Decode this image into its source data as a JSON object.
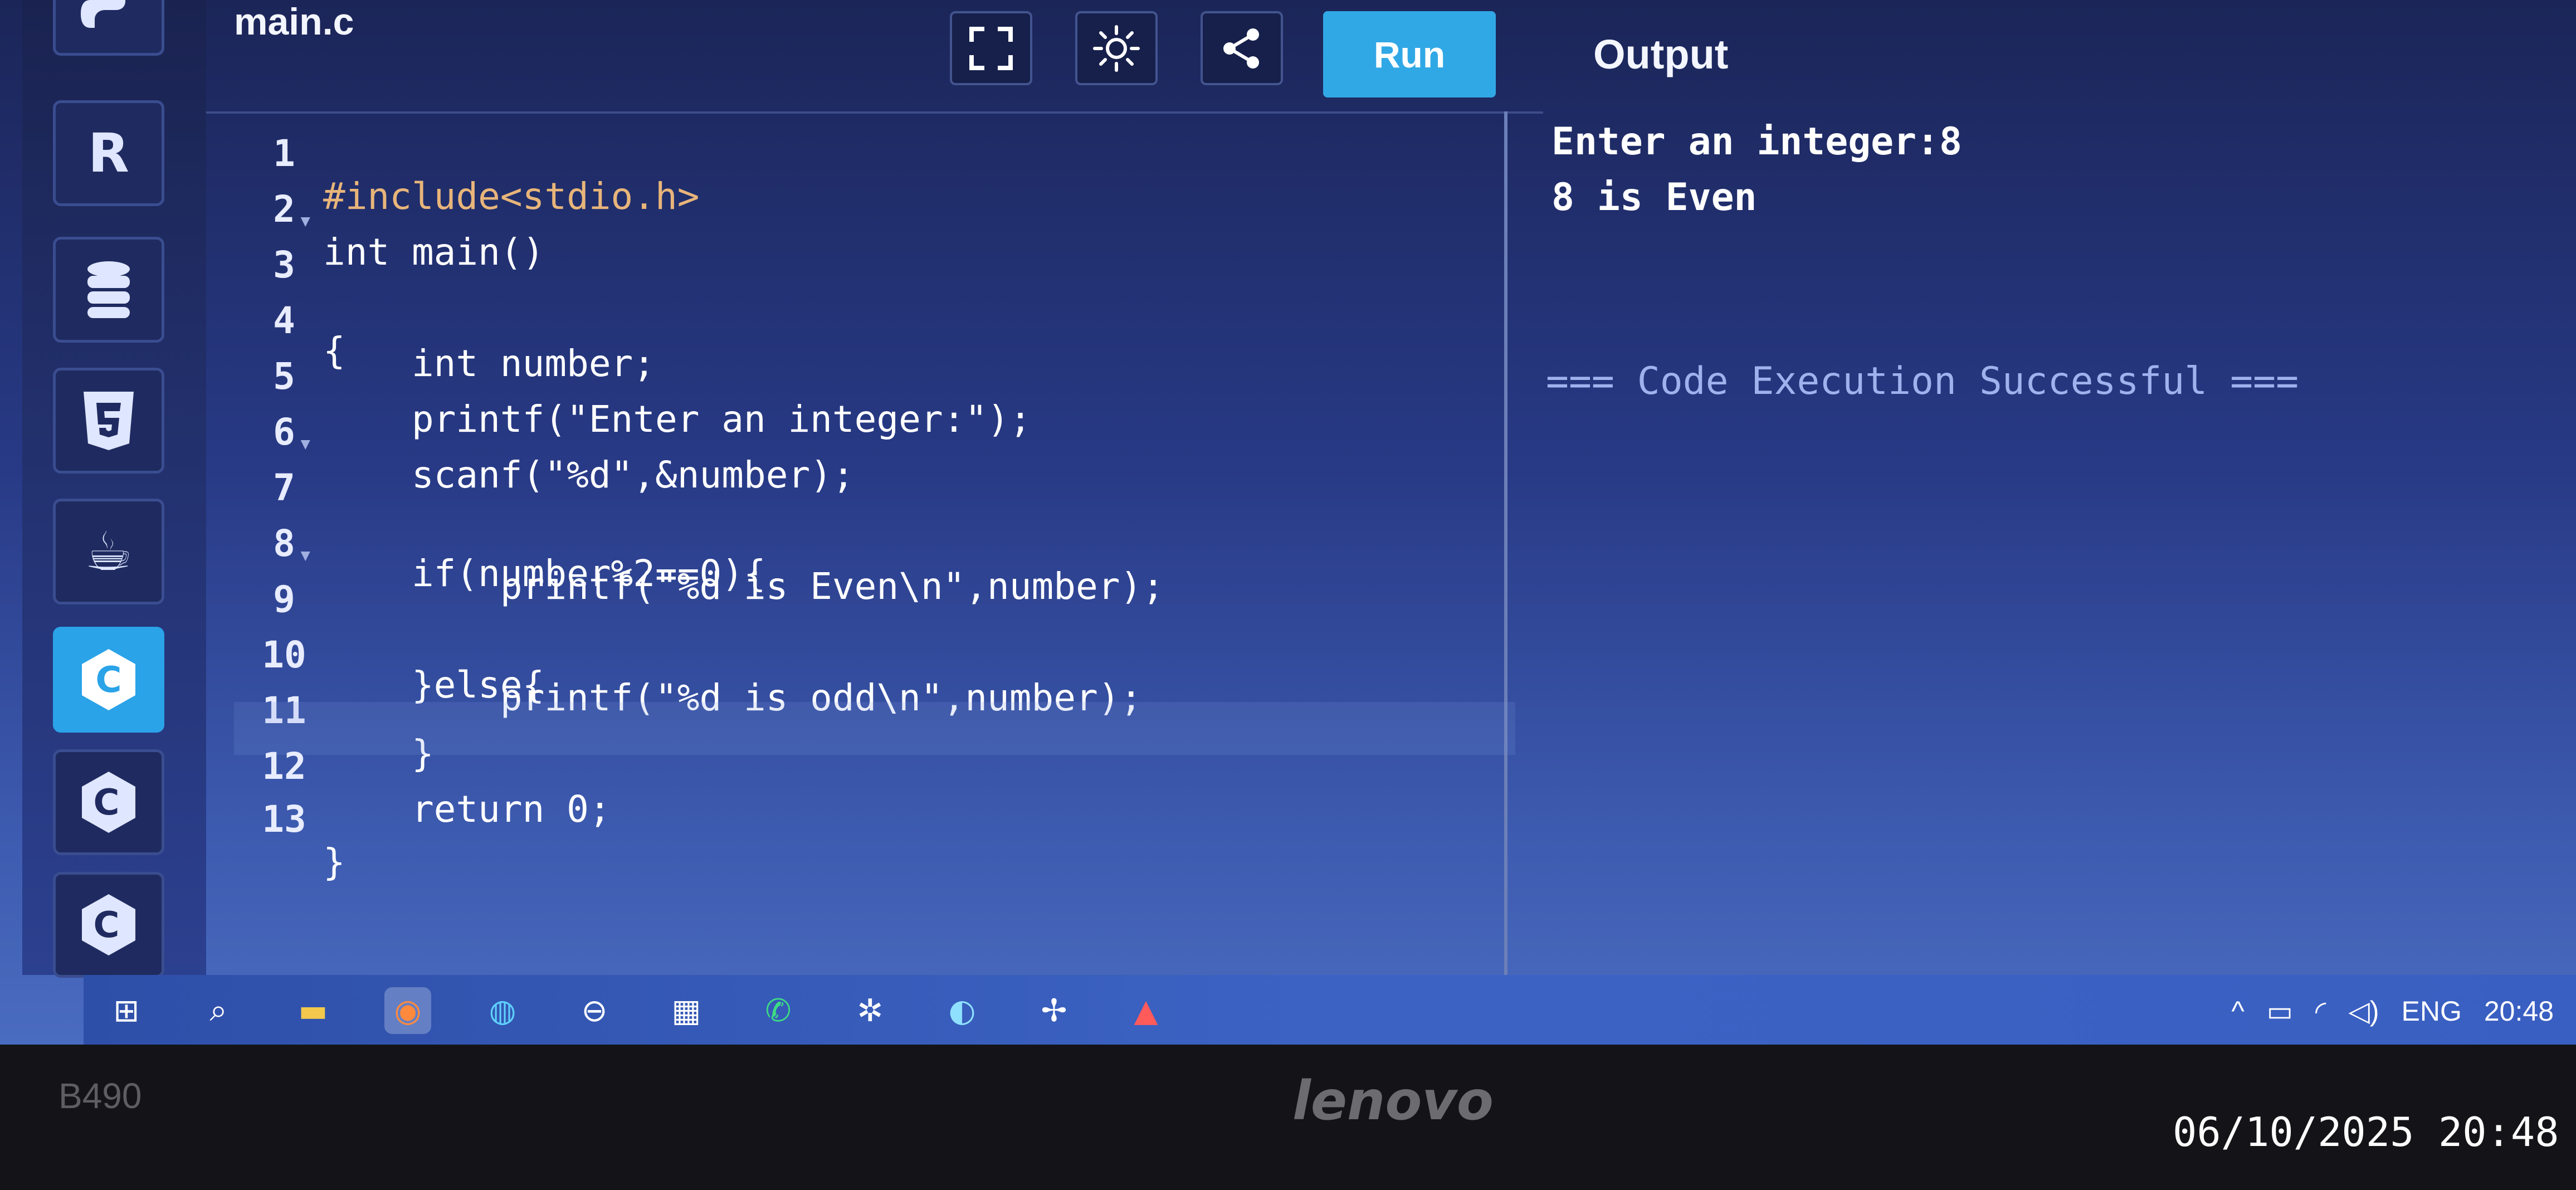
{
  "editor": {
    "filename": "main.c",
    "toolbar": {
      "fullscreen_icon": "fullscreen-icon",
      "theme_icon": "sun-icon",
      "share_icon": "share-icon",
      "run_label": "Run"
    },
    "sidebar": [
      {
        "name": "python",
        "icon": "python-icon"
      },
      {
        "name": "r",
        "icon": "r-icon",
        "glyph": "R"
      },
      {
        "name": "database",
        "icon": "database-icon",
        "glyph": "≣"
      },
      {
        "name": "html5",
        "icon": "html5-icon",
        "glyph": "5"
      },
      {
        "name": "java",
        "icon": "java-icon",
        "glyph": "☕"
      },
      {
        "name": "c",
        "icon": "c-icon",
        "glyph": "C",
        "active": true
      },
      {
        "name": "cpp",
        "icon": "cpp-icon",
        "glyph": "C"
      },
      {
        "name": "csharp",
        "icon": "csharp-icon",
        "glyph": "C"
      }
    ],
    "lines": [
      {
        "n": "1",
        "text": "#include<stdio.h>"
      },
      {
        "n": "2",
        "text": "int main()"
      },
      {
        "n": "3",
        "text": "{"
      },
      {
        "n": "4",
        "text": "    int number;"
      },
      {
        "n": "5",
        "text": "    printf(\"Enter an integer:\");"
      },
      {
        "n": "6",
        "text": "    scanf(\"%d\",&number);"
      },
      {
        "n": "7",
        "text": "    if(number%2==0){"
      },
      {
        "n": "8",
        "text": "        printf(\"%d is Even\\n\",number);"
      },
      {
        "n": "9",
        "text": "    }else{"
      },
      {
        "n": "10",
        "text": "        printf(\"%d is odd\\n\",number);"
      },
      {
        "n": "11",
        "text": "    }"
      },
      {
        "n": "12",
        "text": "    return 0;"
      },
      {
        "n": "13",
        "text": "}"
      }
    ]
  },
  "output": {
    "title": "Output",
    "lines": [
      "Enter an integer:8",
      "8 is Even"
    ],
    "status": "=== Code Execution Successful ==="
  },
  "taskbar": {
    "icons": [
      {
        "name": "start",
        "icon": "windows-icon",
        "glyph": "⊞"
      },
      {
        "name": "search",
        "icon": "search-icon",
        "glyph": "⌕"
      },
      {
        "name": "file-explorer",
        "icon": "folder-icon",
        "glyph": "▬"
      },
      {
        "name": "firefox",
        "icon": "firefox-icon",
        "glyph": "◉",
        "active": true
      },
      {
        "name": "edge-beta",
        "icon": "edge-beta-icon",
        "glyph": "◍"
      },
      {
        "name": "app-minus",
        "icon": "minus-circle-icon",
        "glyph": "⊖"
      },
      {
        "name": "app-bars",
        "icon": "bars-icon",
        "glyph": "▦"
      },
      {
        "name": "whatsapp",
        "icon": "whatsapp-icon",
        "glyph": "✆"
      },
      {
        "name": "chatgpt",
        "icon": "chatgpt-icon",
        "glyph": "✲"
      },
      {
        "name": "app-circle",
        "icon": "circle-app-icon",
        "glyph": "◐"
      },
      {
        "name": "app-pinwheel",
        "icon": "pinwheel-icon",
        "glyph": "✢"
      },
      {
        "name": "pdf-reader",
        "icon": "pdf-icon",
        "glyph": "▲"
      }
    ],
    "tray": {
      "language": "ENG",
      "clock": "20:48"
    }
  },
  "device": {
    "model": "B490",
    "brand": "lenovo"
  },
  "photo_timestamp": "06/10/2025 20:48"
}
